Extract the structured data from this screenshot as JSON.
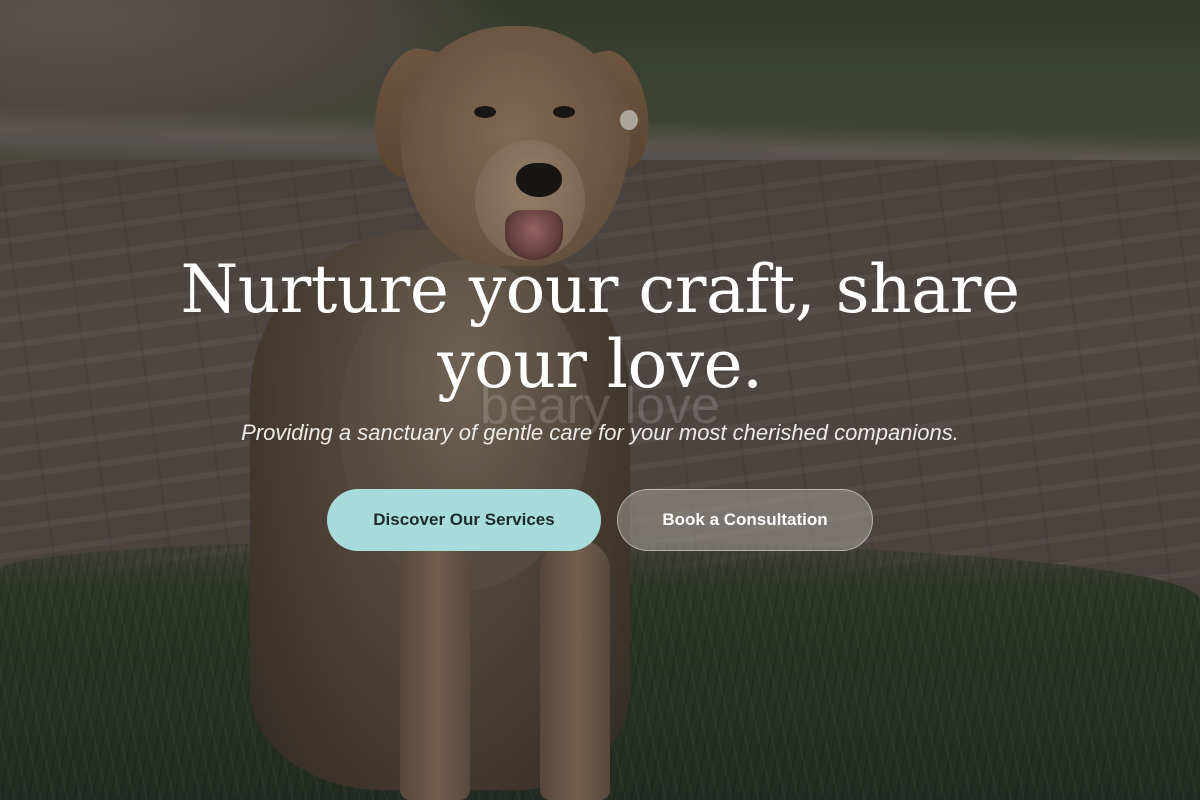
{
  "hero": {
    "headline": "Nurture your craft, share your love.",
    "watermark": "beary love",
    "tagline": "Providing a sanctuary of gentle care for your most cherished companions.",
    "primary_button_label": "Discover Our Services",
    "secondary_button_label": "Book a Consultation"
  },
  "colors": {
    "primary_button_bg": "#a8dcdc",
    "primary_button_text": "#1e2a2c",
    "headline_text": "#ffffff"
  }
}
